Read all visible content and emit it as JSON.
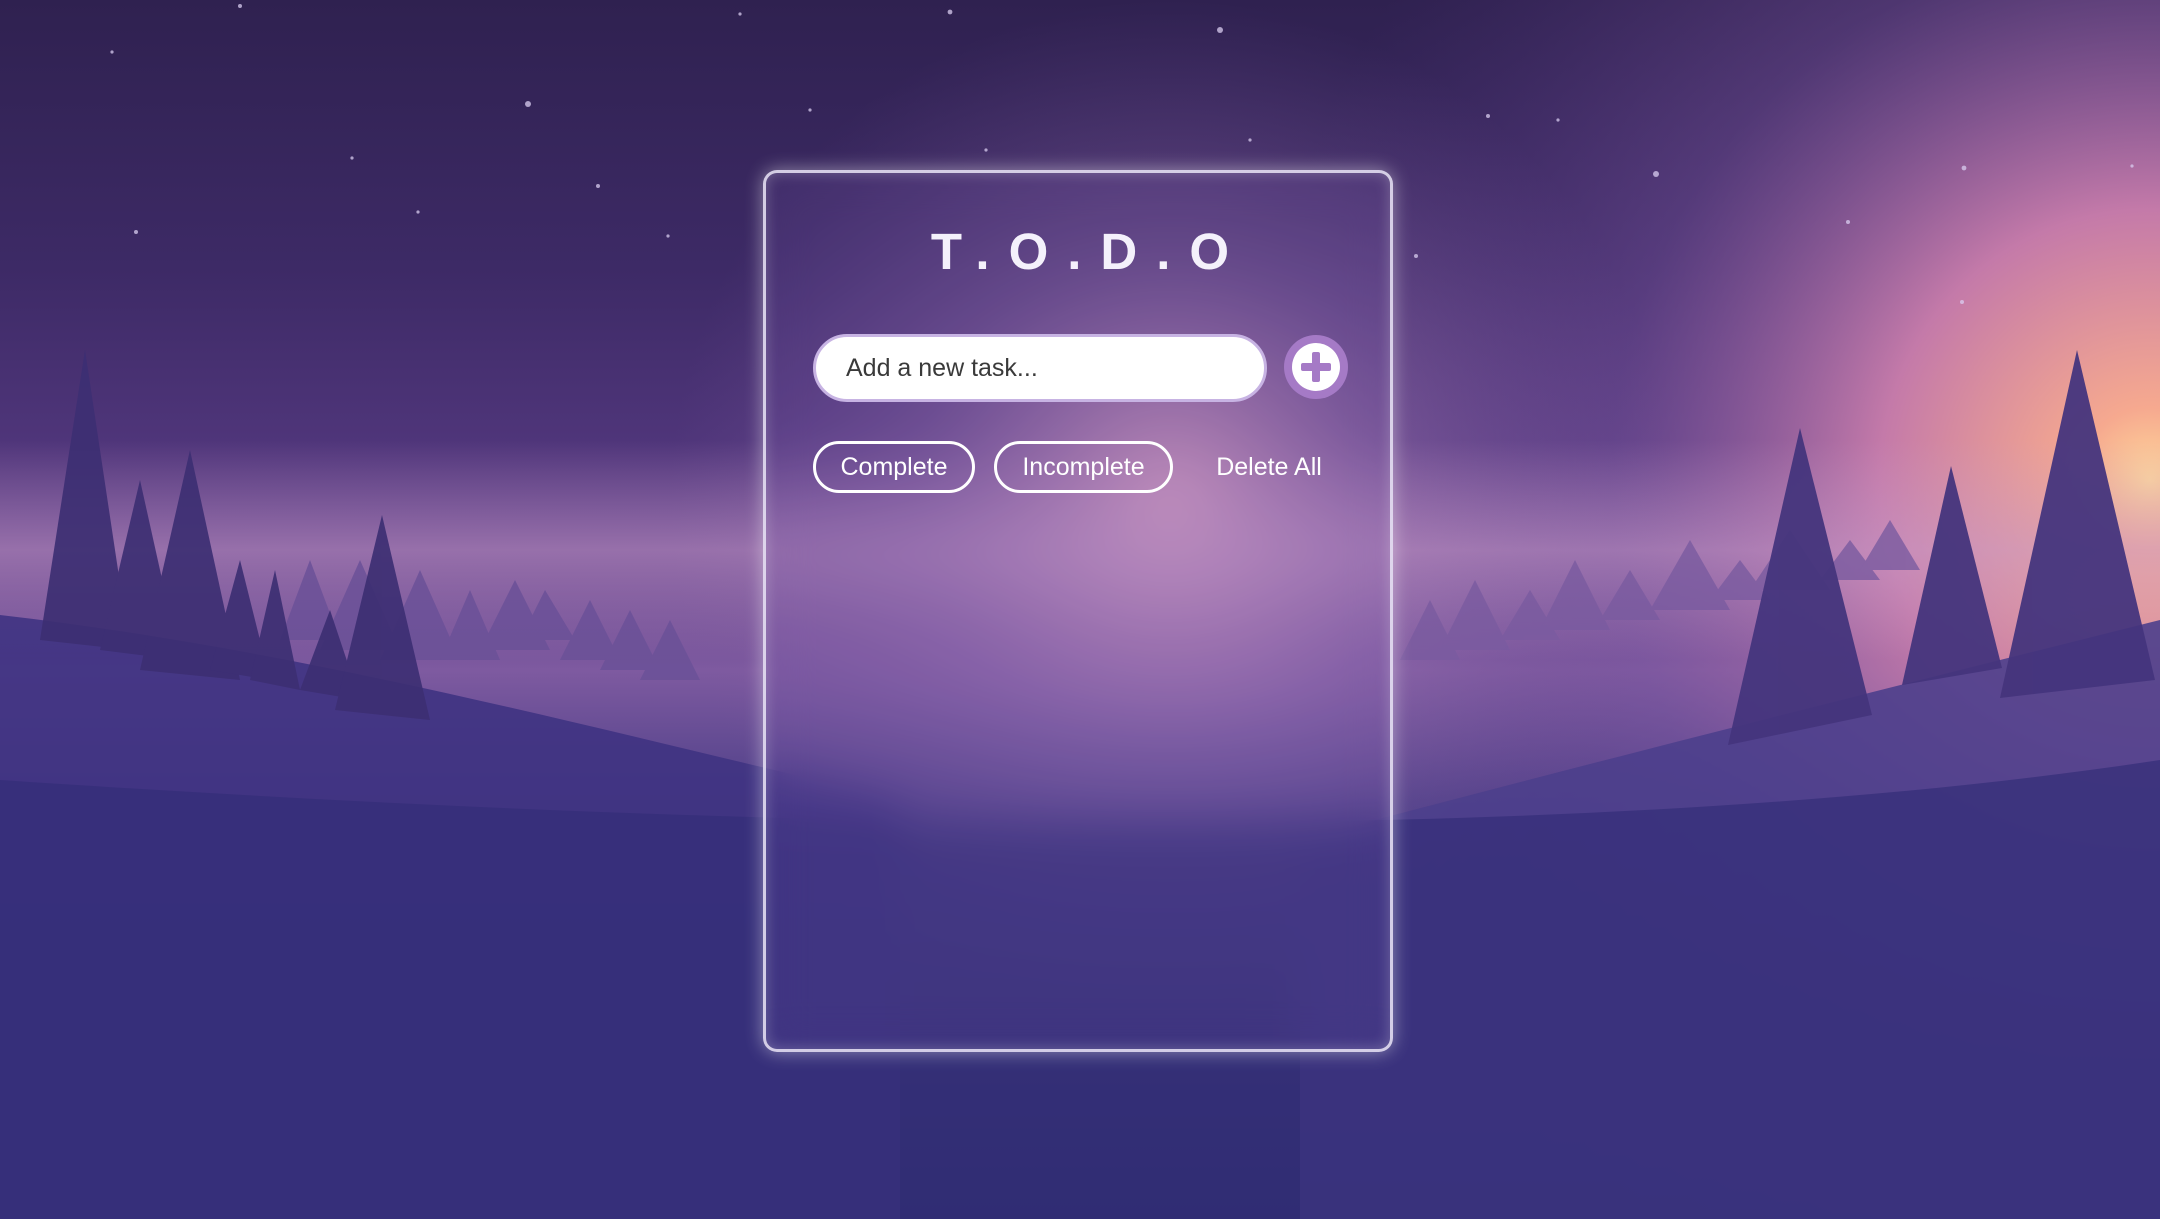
{
  "app": {
    "title": "T.O.D.O"
  },
  "new_task": {
    "placeholder": "Add a new task...",
    "add_icon": "plus-icon"
  },
  "filters": {
    "complete_label": "Complete",
    "incomplete_label": "Incomplete",
    "delete_all_label": "Delete All"
  },
  "colors": {
    "accent": "#a57ac6",
    "card_border": "#e8e4f5",
    "text": "#ffffff"
  }
}
